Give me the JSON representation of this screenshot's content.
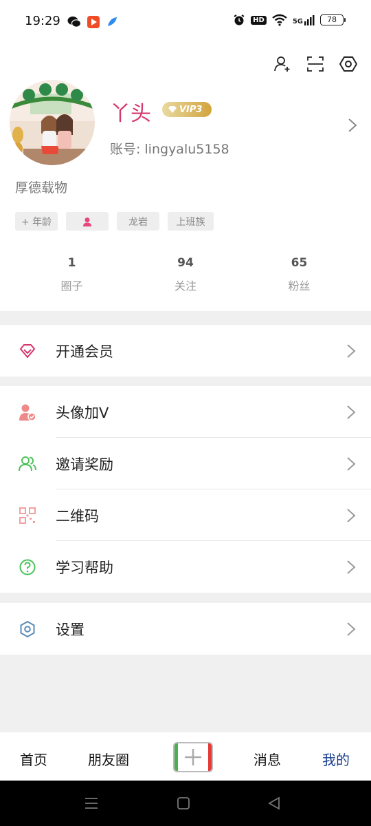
{
  "status_bar": {
    "time": "19:29",
    "battery": "78",
    "network": "5G",
    "hd": "HD"
  },
  "profile": {
    "name": "丫头",
    "vip_label": "VIP3",
    "account_label": "账号:",
    "account_value": "lingyalu5158",
    "motto": "厚德载物",
    "tags": [
      "+ 年龄",
      "",
      "龙岩",
      "上班族"
    ],
    "stats": [
      {
        "value": "1",
        "label": "圈子"
      },
      {
        "value": "94",
        "label": "关注"
      },
      {
        "value": "65",
        "label": "粉丝"
      }
    ]
  },
  "menu": {
    "vip": "开通会员",
    "avatar_v": "头像加V",
    "invite": "邀请奖励",
    "qrcode": "二维码",
    "help": "学习帮助",
    "settings": "设置"
  },
  "bottom_nav": {
    "home": "首页",
    "moments": "朋友圈",
    "messages": "消息",
    "mine": "我的"
  },
  "colors": {
    "accent_name": "#d4376a",
    "nav_active": "#1a3d8f",
    "green": "#4caf50"
  }
}
